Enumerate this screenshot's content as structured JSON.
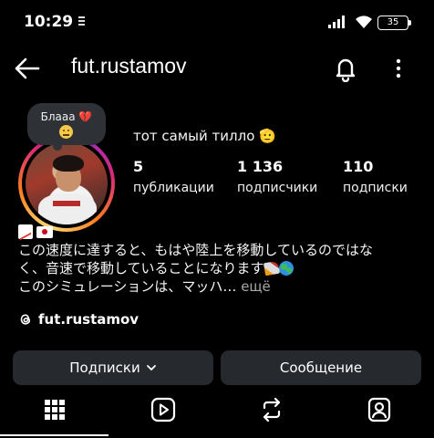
{
  "status_bar": {
    "time": "10:29",
    "battery": "35"
  },
  "header": {
    "title": "fut.rustamov",
    "back_icon": "arrow-left-icon",
    "notification_icon": "bell-icon",
    "more_icon": "vertical-dots-icon"
  },
  "note": {
    "text": "Блааа 💔"
  },
  "profile": {
    "name": "тот самый тилло 🫡",
    "stats": [
      {
        "value": "5",
        "label": "публикации"
      },
      {
        "value": "1 136",
        "label": "подписчики"
      },
      {
        "value": "110",
        "label": "подписки"
      }
    ],
    "bio_lines": [
      "この速度に達すると、もはや陸上を移動しているのではな",
      "く、音速で移動していることになります",
      "このシミュレーションは、マッハ…"
    ],
    "bio_more": "ещё",
    "threads_handle": "fut.rustamov"
  },
  "buttons": {
    "subscriptions": "Подписки",
    "message": "Сообщение"
  },
  "tabs": [
    {
      "icon": "grid-icon",
      "active": true
    },
    {
      "icon": "reels-icon",
      "active": false
    },
    {
      "icon": "repost-icon",
      "active": false
    },
    {
      "icon": "tagged-icon",
      "active": false
    }
  ]
}
